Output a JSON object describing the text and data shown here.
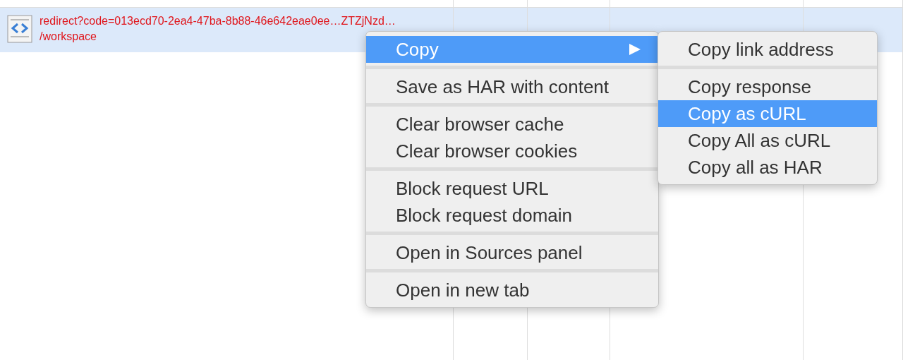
{
  "table": {
    "rows": [
      {
        "selected": true,
        "error": true,
        "name": "redirect?code=013ecd70-2ea4-47ba-8b88-46e642eae0ee…ZTZjNzd…",
        "path": "/workspace"
      }
    ]
  },
  "context_menu": {
    "groups": [
      [
        {
          "label": "Copy",
          "kind": "submenu",
          "selected": true
        }
      ],
      [
        {
          "label": "Save as HAR with content",
          "kind": "action",
          "selected": false
        }
      ],
      [
        {
          "label": "Clear browser cache",
          "kind": "action",
          "selected": false
        },
        {
          "label": "Clear browser cookies",
          "kind": "action",
          "selected": false
        }
      ],
      [
        {
          "label": "Block request URL",
          "kind": "action",
          "selected": false
        },
        {
          "label": "Block request domain",
          "kind": "action",
          "selected": false
        }
      ],
      [
        {
          "label": "Open in Sources panel",
          "kind": "action",
          "selected": false
        }
      ],
      [
        {
          "label": "Open in new tab",
          "kind": "action",
          "selected": false
        }
      ]
    ]
  },
  "submenu": {
    "groups": [
      [
        {
          "label": "Copy link address",
          "selected": false
        }
      ],
      [
        {
          "label": "Copy response",
          "selected": false
        },
        {
          "label": "Copy as cURL",
          "selected": true
        },
        {
          "label": "Copy All as cURL",
          "selected": false
        },
        {
          "label": "Copy all as HAR",
          "selected": false
        }
      ]
    ]
  }
}
